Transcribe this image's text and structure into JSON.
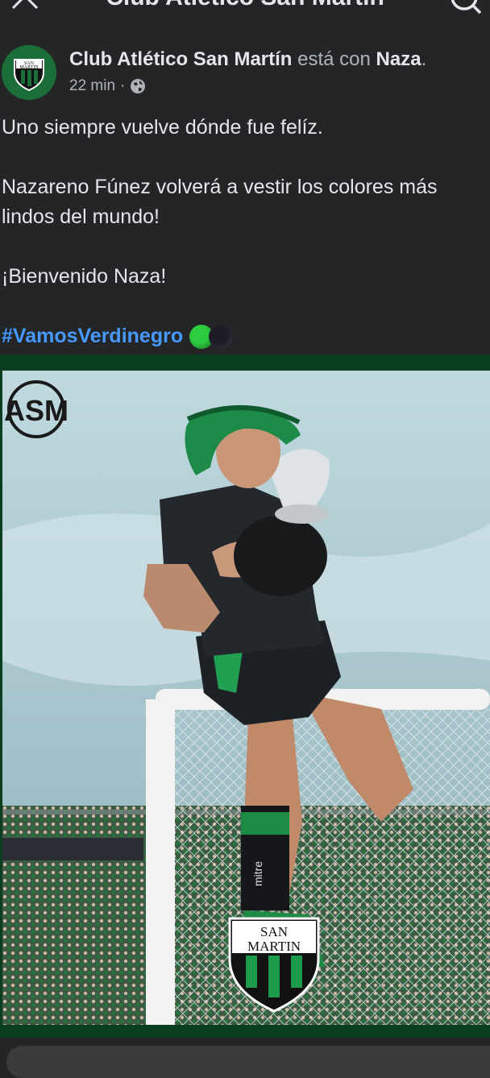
{
  "topbar": {
    "title": "Club Atlético San Martín",
    "close_icon": "close-icon",
    "search_icon": "search-icon"
  },
  "post": {
    "author": "Club Atlético San Martín",
    "with_text": "está con",
    "tagged_user": "Naza",
    "time": "22 min",
    "separator": "·",
    "audience_icon": "globe-icon",
    "lines": {
      "l1": "Uno siempre vuelve dónde fue felíz.",
      "l2": "Nazareno Fúnez volverá a vestir los colores más lindos del mundo!",
      "l3": "¡Bienvenido Naza!",
      "hashtag": "#VamosVerdinegro"
    },
    "emoji": [
      "green-circle",
      "black-circle"
    ]
  },
  "photo": {
    "logo_top": "ASM",
    "crest_line1": "SAN",
    "crest_line2": "MARTIN",
    "sock_brand": "mitre"
  },
  "avatar": {
    "line1": "SAN",
    "line2": "MARTIN"
  },
  "colors": {
    "background": "#242526",
    "text": "#e4e6eb",
    "muted": "#b0b3b8",
    "hashtag": "#4599ff",
    "club_green": "#1b6e38"
  }
}
